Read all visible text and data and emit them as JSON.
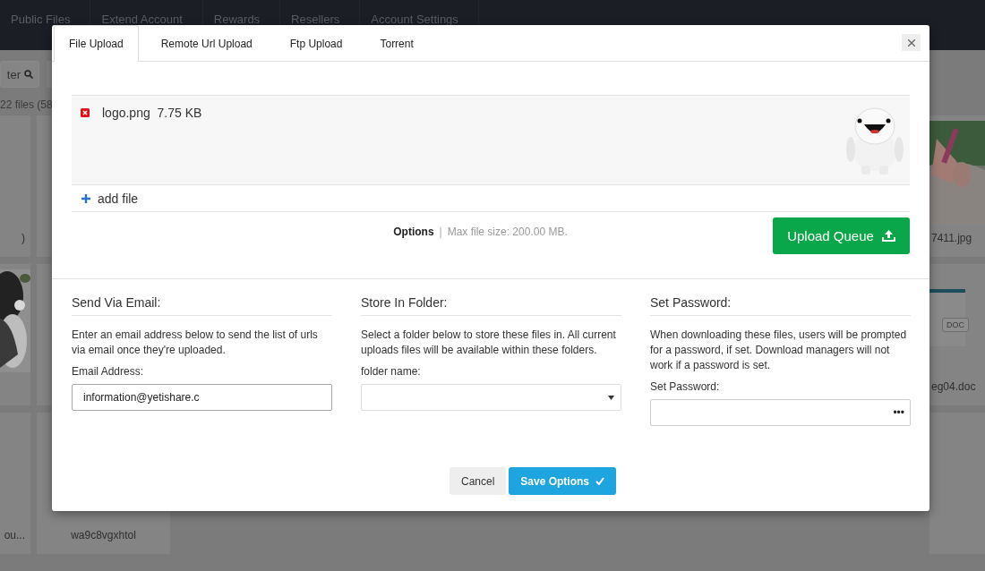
{
  "background": {
    "nav": [
      {
        "label": "Public Files"
      },
      {
        "label": "Extend Account"
      },
      {
        "label": "Rewards"
      },
      {
        "label": "Resellers"
      },
      {
        "label": "Account Settings"
      }
    ],
    "filter_button": "ter",
    "file_count": "22 files (58",
    "columns": [
      {
        "tiles": [
          {
            "kind": "blank",
            "label": ")"
          },
          {
            "kind": "picture"
          },
          {
            "kind": "blank",
            "label": "ou..."
          }
        ]
      },
      {
        "tiles": [
          {
            "kind": "blank"
          },
          {
            "kind": "blank"
          },
          {
            "kind": "blank",
            "label": "wa9c8vgxhtol"
          }
        ]
      },
      {
        "tiles": [
          {
            "kind": "picture",
            "label": "7411.jpg"
          },
          {
            "kind": "doc",
            "badge": "DOC",
            "label": "eg04.doc"
          },
          {
            "kind": "blank"
          }
        ]
      }
    ]
  },
  "modal": {
    "tabs": [
      {
        "label": "File Upload",
        "selected": true
      },
      {
        "label": "Remote Url Upload",
        "selected": false
      },
      {
        "label": "Ftp Upload",
        "selected": false
      },
      {
        "label": "Torrent",
        "selected": false
      }
    ],
    "queue": [
      {
        "name": "logo.png",
        "size": "7.75 KB"
      }
    ],
    "add_file": "add file",
    "options_link": "Options",
    "separator": "|",
    "max_size": "Max file size: 200.00 MB.",
    "upload_button": "Upload Queue",
    "sections": [
      {
        "heading": "Send Via Email:",
        "text": "Enter an email address below to send the list of urls via email once they're uploaded.",
        "label": "Email Address:",
        "kind": "text",
        "value": "information@yetishare.c"
      },
      {
        "heading": "Store In Folder:",
        "text": "Select a folder below to store these files in. All current uploads files will be available within these folders.",
        "label": "folder name:",
        "kind": "select"
      },
      {
        "heading": "Set Password:",
        "text": "When downloading these files, users will be prompted for a password, if set. Download managers will not work if a password is set.",
        "label": "Set Password:",
        "kind": "password",
        "value": "•••"
      }
    ],
    "buttons": [
      {
        "label": "Cancel",
        "kind": "secondary"
      },
      {
        "label": "Save Options",
        "kind": "primary"
      }
    ]
  }
}
